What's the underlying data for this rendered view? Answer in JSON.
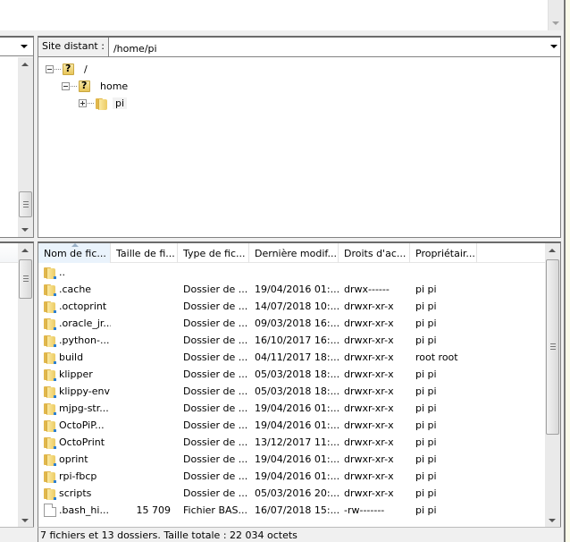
{
  "remote": {
    "address_label": "Site distant :",
    "address_value": "/home/pi",
    "tree": [
      {
        "label": "/",
        "icon": "unknown-folder-icon",
        "toggle": "collapse"
      },
      {
        "label": "home",
        "icon": "unknown-folder-icon",
        "toggle": "collapse"
      },
      {
        "label": "pi",
        "icon": "folder-icon",
        "toggle": "expand",
        "selected": true
      }
    ]
  },
  "list": {
    "columns": [
      {
        "label": "Nom de fic...",
        "sorted": true
      },
      {
        "label": "Taille de fi..."
      },
      {
        "label": "Type de fic..."
      },
      {
        "label": "Dernière modif..."
      },
      {
        "label": "Droits d'ac..."
      },
      {
        "label": "Propriétair..."
      }
    ],
    "rows": [
      {
        "icon": "folder-icon",
        "name": "..",
        "size": "",
        "type": "",
        "date": "",
        "perm": "",
        "owner": ""
      },
      {
        "icon": "folder-icon",
        "name": ".cache",
        "size": "",
        "type": "Dossier de ...",
        "date": "19/04/2016 01:...",
        "perm": "drwx------",
        "owner": "pi pi"
      },
      {
        "icon": "folder-icon",
        "name": ".octoprint",
        "size": "",
        "type": "Dossier de ...",
        "date": "14/07/2018 10:...",
        "perm": "drwxr-xr-x",
        "owner": "pi pi"
      },
      {
        "icon": "folder-icon",
        "name": ".oracle_jr...",
        "size": "",
        "type": "Dossier de ...",
        "date": "09/03/2018 16:...",
        "perm": "drwxr-xr-x",
        "owner": "pi pi"
      },
      {
        "icon": "folder-icon",
        "name": ".python-...",
        "size": "",
        "type": "Dossier de ...",
        "date": "16/10/2017 16:...",
        "perm": "drwxr-xr-x",
        "owner": "pi pi"
      },
      {
        "icon": "folder-icon",
        "name": "build",
        "size": "",
        "type": "Dossier de ...",
        "date": "04/11/2017 18:...",
        "perm": "drwxr-xr-x",
        "owner": "root root"
      },
      {
        "icon": "folder-icon",
        "name": "klipper",
        "size": "",
        "type": "Dossier de ...",
        "date": "05/03/2018 18:...",
        "perm": "drwxr-xr-x",
        "owner": "pi pi"
      },
      {
        "icon": "folder-icon",
        "name": "klippy-env",
        "size": "",
        "type": "Dossier de ...",
        "date": "05/03/2018 18:...",
        "perm": "drwxr-xr-x",
        "owner": "pi pi"
      },
      {
        "icon": "folder-icon",
        "name": "mjpg-str...",
        "size": "",
        "type": "Dossier de ...",
        "date": "19/04/2016 01:...",
        "perm": "drwxr-xr-x",
        "owner": "pi pi"
      },
      {
        "icon": "folder-icon",
        "name": "OctoPiP...",
        "size": "",
        "type": "Dossier de ...",
        "date": "19/04/2016 01:...",
        "perm": "drwxr-xr-x",
        "owner": "pi pi"
      },
      {
        "icon": "folder-icon",
        "name": "OctoPrint",
        "size": "",
        "type": "Dossier de ...",
        "date": "13/12/2017 11:...",
        "perm": "drwxr-xr-x",
        "owner": "pi pi"
      },
      {
        "icon": "folder-icon",
        "name": "oprint",
        "size": "",
        "type": "Dossier de ...",
        "date": "19/04/2016 01:...",
        "perm": "drwxr-xr-x",
        "owner": "pi pi"
      },
      {
        "icon": "folder-icon",
        "name": "rpi-fbcp",
        "size": "",
        "type": "Dossier de ...",
        "date": "19/04/2016 01:...",
        "perm": "drwxr-xr-x",
        "owner": "pi pi"
      },
      {
        "icon": "folder-icon",
        "name": "scripts",
        "size": "",
        "type": "Dossier de ...",
        "date": "05/03/2016 20:...",
        "perm": "drwxr-xr-x",
        "owner": "pi pi"
      },
      {
        "icon": "file-icon",
        "name": ".bash_hi...",
        "size": "15 709",
        "type": "Fichier BAS...",
        "date": "16/07/2018 15:...",
        "perm": "-rw-------",
        "owner": "pi pi"
      }
    ]
  },
  "status": {
    "text": "7 fichiers et 13 dossiers. Taille totale : 22 034 octets"
  }
}
